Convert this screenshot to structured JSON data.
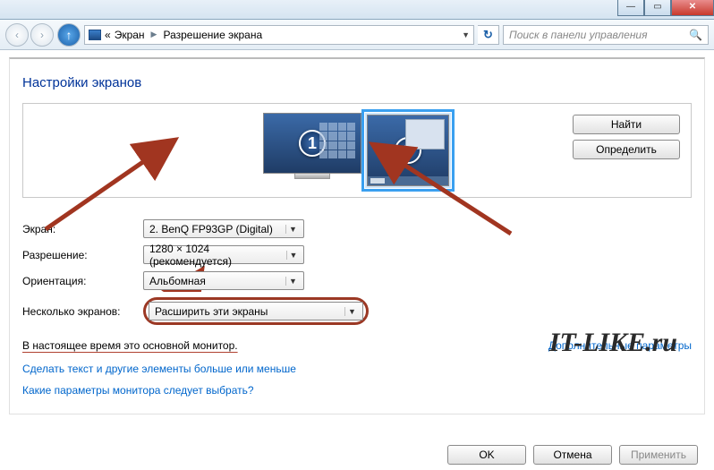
{
  "titlebar": {
    "min": "—",
    "max": "▭",
    "close": "✕"
  },
  "nav": {
    "back": "‹",
    "fwd": "›",
    "up": "↑",
    "crumb_prefix": "«",
    "crumb1": "Экран",
    "crumb2": "Разрешение экрана",
    "search_placeholder": "Поиск в панели управления"
  },
  "page_title": "Настройки экранов",
  "monitors": {
    "num1": "1",
    "num2": "2"
  },
  "buttons": {
    "find": "Найти",
    "detect": "Определить",
    "ok": "OK",
    "cancel": "Отмена",
    "apply": "Применить"
  },
  "labels": {
    "screen": "Экран:",
    "resolution": "Разрешение:",
    "orientation": "Ориентация:",
    "multi": "Несколько экранов:"
  },
  "values": {
    "screen": "2. BenQ FP93GP (Digital)",
    "resolution": "1280 × 1024 (рекомендуется)",
    "orientation": "Альбомная",
    "multi": "Расширить эти экраны"
  },
  "status": "В настоящее время это основной монитор.",
  "links": {
    "adv": "Дополнительные параметры",
    "text_size": "Сделать текст и другие элементы больше или меньше",
    "which_monitor": "Какие параметры монитора следует выбрать?"
  },
  "watermark": "IT-LIKE.ru"
}
